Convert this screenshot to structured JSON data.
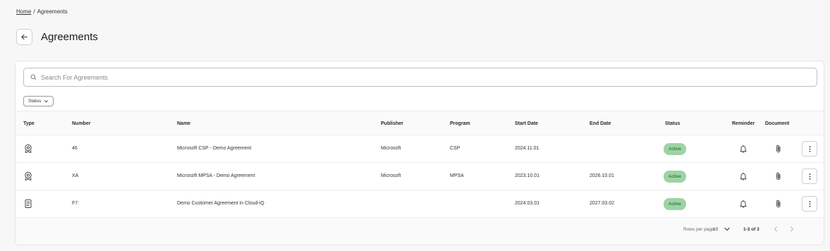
{
  "breadcrumb": {
    "home": "Home",
    "separator": "/",
    "current": "Agreements"
  },
  "header": {
    "title": "Agreements",
    "back_icon": "arrow-left-icon"
  },
  "search": {
    "placeholder": "Search For Agreements",
    "value": "",
    "icon": "search-icon"
  },
  "filters": {
    "status_label": "Status"
  },
  "table": {
    "columns": {
      "type": "Type",
      "number": "Number",
      "name": "Name",
      "publisher": "Publisher",
      "program": "Program",
      "start_date": "Start Date",
      "end_date": "End Date",
      "status": "Status",
      "reminder": "Reminder",
      "document": "Document"
    },
    "rows": [
      {
        "type_icon": "badge-certificate-icon",
        "number": "46",
        "name": "Microsoft CSP - Demo Agreement",
        "publisher": "Microsoft",
        "program": "CSP",
        "start_date": "2024.11.01",
        "end_date": "",
        "status": "Active"
      },
      {
        "type_icon": "badge-certificate-icon",
        "number": "XA",
        "name": "Microsoft MPSA - Demo Agreement",
        "publisher": "Microsoft",
        "program": "MPSA",
        "start_date": "2023.10.01",
        "end_date": "2026.10.01",
        "status": "Active"
      },
      {
        "type_icon": "document-icon",
        "number": "F7:",
        "name": "Demo Customer Agreement in Cloud-iQ",
        "publisher": "",
        "program": "",
        "start_date": "2024.03.01",
        "end_date": "2027.03.02",
        "status": "Active"
      }
    ]
  },
  "pagination": {
    "rows_per_page_label": "Rows per page:",
    "rows_per_page": "10",
    "range": "1-3 of 3"
  },
  "colors": {
    "status_active_bg": "#9dd4a4",
    "status_active_text": "#1d5c28"
  }
}
